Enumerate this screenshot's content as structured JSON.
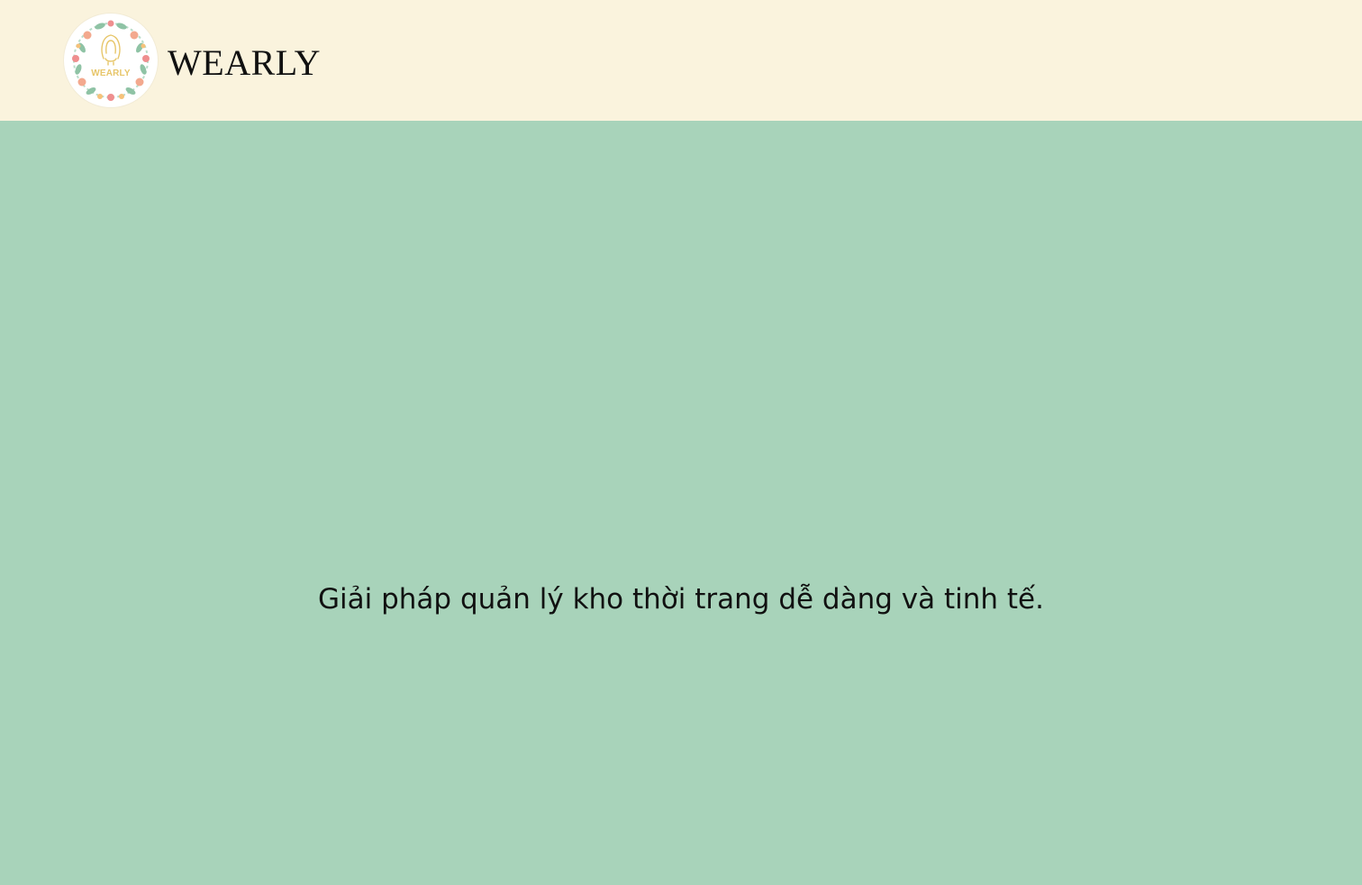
{
  "header": {
    "logo_text": "WEARLY",
    "brand_name": "WEARLY"
  },
  "main": {
    "tagline": "Giải pháp quản lý kho thời trang dễ dàng và tinh tế."
  },
  "colors": {
    "header_background": "#faf3dd",
    "page_background": "#a8d3ba",
    "logo_accent": "#e7c66a",
    "text": "#111111"
  },
  "icons": {
    "logo": "floral-wreath-woman-icon"
  }
}
